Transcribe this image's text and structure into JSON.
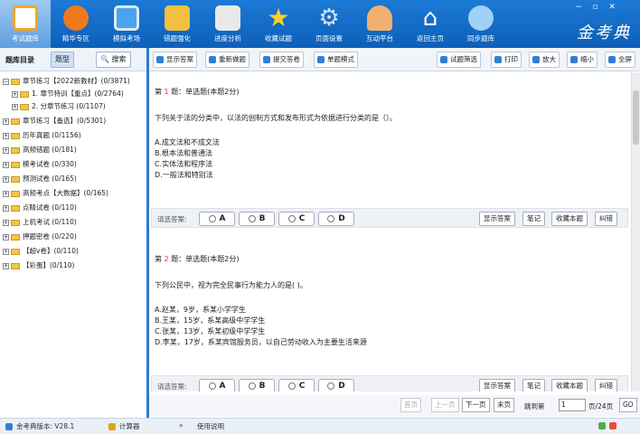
{
  "nav": {
    "items": [
      {
        "label": "考试题库",
        "icon": "book-icon",
        "color": "#f5a623"
      },
      {
        "label": "精华专区",
        "icon": "play-icon",
        "color": "#f07a1a"
      },
      {
        "label": "模拟考场",
        "icon": "computer-icon",
        "color": "#4aa3f0"
      },
      {
        "label": "错题强化",
        "icon": "lock-icon",
        "color": "#f2c040"
      },
      {
        "label": "进度分析",
        "icon": "bar-chart-icon",
        "color": "#e8e8e8"
      },
      {
        "label": "收藏试题",
        "icon": "star-icon",
        "color": "#ffd21f"
      },
      {
        "label": "页面设置",
        "icon": "gear-icon",
        "color": "#d8e4f0"
      },
      {
        "label": "互动平台",
        "icon": "people-icon",
        "color": "#f0b070"
      },
      {
        "label": "返回主页",
        "icon": "home-icon",
        "color": "#e84c3d"
      },
      {
        "label": "同步题库",
        "icon": "cloud-sync-icon",
        "color": "#9fd0f5"
      }
    ],
    "logo": "金考典"
  },
  "window": {
    "minimize": "−",
    "restore": "▫",
    "close": "✕"
  },
  "left": {
    "title": "题库目录",
    "tab_question": "题型",
    "tab_search": "搜索",
    "tree": [
      {
        "label": "章节练习【2022新教材】(0/3871)",
        "level": 0,
        "toggle": "−"
      },
      {
        "label": "1. 章节特训【重点】(0/2764)",
        "level": 1,
        "toggle": "+"
      },
      {
        "label": "2. 分章节练习 (0/1107)",
        "level": 1,
        "toggle": "+"
      },
      {
        "label": "章节练习【备选】(0/5301)",
        "level": 0,
        "toggle": "+"
      },
      {
        "label": "历年真题 (0/1156)",
        "level": 0,
        "toggle": "+"
      },
      {
        "label": "高频错题 (0/181)",
        "level": 0,
        "toggle": "+"
      },
      {
        "label": "模考试卷 (0/330)",
        "level": 0,
        "toggle": "+"
      },
      {
        "label": "预测试卷 (0/165)",
        "level": 0,
        "toggle": "+"
      },
      {
        "label": "高频考点【大数据】(0/165)",
        "level": 0,
        "toggle": "+"
      },
      {
        "label": "点睛试卷 (0/110)",
        "level": 0,
        "toggle": "+"
      },
      {
        "label": "上机考试 (0/110)",
        "level": 0,
        "toggle": "+"
      },
      {
        "label": "押题密卷 (0/220)",
        "level": 0,
        "toggle": "+"
      },
      {
        "label": "【超v卷】(0/110)",
        "level": 0,
        "toggle": "+"
      },
      {
        "label": "【彩蛋】(0/110)",
        "level": 0,
        "toggle": "+"
      }
    ]
  },
  "toolbar": {
    "show_answer": "显示答案",
    "redo": "重新做题",
    "submit": "提交答卷",
    "single_mode": "单题模式",
    "filter": "试题筛选",
    "print": "打印",
    "zoom_in": "放大",
    "zoom_out": "缩小",
    "fullscreen": "全屏"
  },
  "questions": [
    {
      "prefix": "第",
      "num": "1",
      "suffix": "题：单选题(本题2分)",
      "stem": "下列关于法的分类中，以法的创制方式和发布形式为依据进行分类的是（）。",
      "options": [
        "A.成文法和不成文法",
        "B.根本法和普通法",
        "C.实体法和程序法",
        "D.一般法和特别法"
      ]
    },
    {
      "prefix": "第",
      "num": "2",
      "suffix": "题：单选题(本题2分)",
      "stem": "下列公民中，视为完全民事行为能力人的是( )。",
      "options": [
        "A.赵某，9岁，系某小学学生",
        "B.王某，15岁，系某高级中学学生",
        "C.张某，13岁，系某初级中学学生",
        "D.李某，17岁，系某宾馆服务员，以自己劳动收入为主要生活来源"
      ]
    }
  ],
  "answer": {
    "prompt": "请选答案:",
    "choices": [
      "A",
      "B",
      "C",
      "D"
    ],
    "show_answer": "显示答案",
    "notes": "笔记",
    "favorite": "收藏本题",
    "correct": "纠错"
  },
  "pager": {
    "first": "首页",
    "prev": "上一页",
    "next": "下一页",
    "last": "末页",
    "jump": "跳到第",
    "current": "1",
    "total": "页/24页",
    "go": "GO"
  },
  "status": {
    "version": "金考典版本: V28.1",
    "calculator": "计算器",
    "guide_arrow": "»",
    "guide": "使用说明"
  }
}
